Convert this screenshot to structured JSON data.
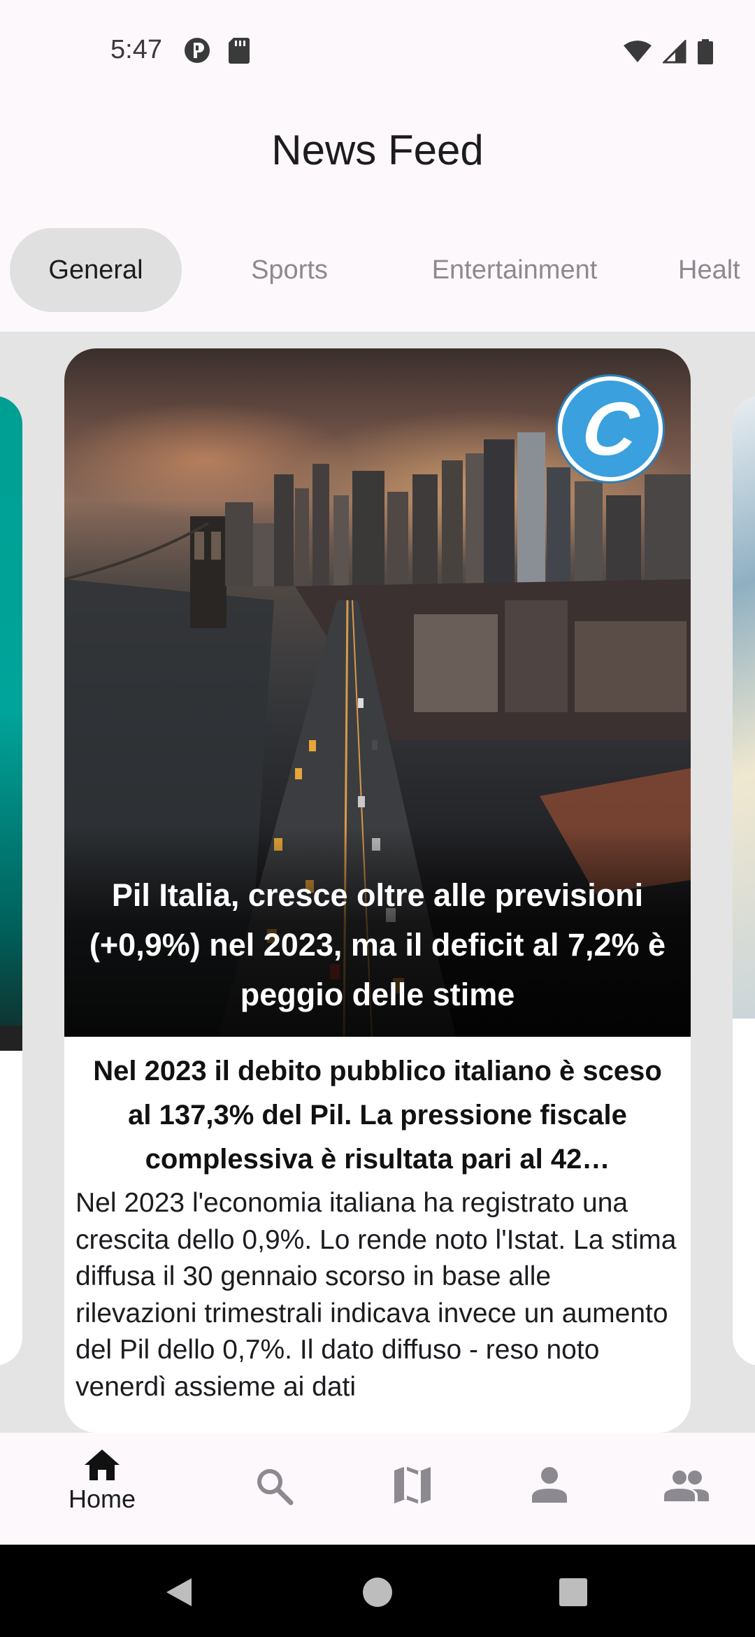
{
  "status_bar": {
    "time": "5:47",
    "left_icons": [
      "media-app-icon",
      "sd-card-icon"
    ],
    "right_icons": [
      "wifi-icon",
      "cellular-signal-icon",
      "battery-icon"
    ]
  },
  "header": {
    "title": "News Feed"
  },
  "tabs": [
    {
      "label": "General",
      "active": true
    },
    {
      "label": "Sports",
      "active": false
    },
    {
      "label": "Entertainment",
      "active": false
    },
    {
      "label": "Healt",
      "active": false
    }
  ],
  "article": {
    "source_logo_letter": "C",
    "headline": "Pil Italia, cresce oltre alle previsioni (+0,9%) nel 2023, ma il deficit al 7,2% è peggio delle stime",
    "subtitle": "Nel 2023 il debito pubblico italiano è sceso al 137,3% del Pil.  La pressione fiscale complessiva è risultata pari al 42…",
    "body": "Nel 2023 l'economia italiana ha registrato una crescita dello 0,9%. Lo rende noto l'Istat. La stima diffusa il 30 gennaio scorso in base alle rilevazioni trimestrali indicava invece un aumento del Pil dello 0,7%. Il dato diffuso - reso noto venerdì assieme ai dati"
  },
  "bottom_nav": {
    "items": [
      {
        "name": "home",
        "label": "Home",
        "icon": "home-icon",
        "active": true
      },
      {
        "name": "search",
        "label": "",
        "icon": "search-icon",
        "active": false
      },
      {
        "name": "map",
        "label": "",
        "icon": "map-icon",
        "active": false
      },
      {
        "name": "profile",
        "label": "",
        "icon": "person-icon",
        "active": false
      },
      {
        "name": "group",
        "label": "",
        "icon": "people-icon",
        "active": false
      }
    ]
  },
  "colors": {
    "background": "#fdf8fc",
    "tab_active_bg": "#e0e0e0",
    "logo_blue": "#3aa0de",
    "inactive_icon": "#8c8a90"
  }
}
